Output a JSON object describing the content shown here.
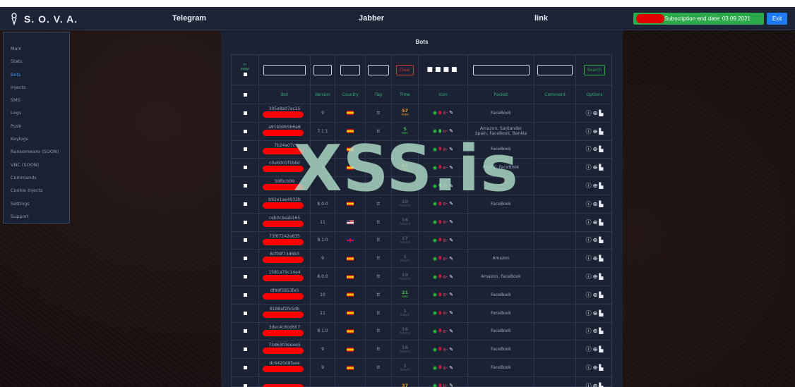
{
  "header": {
    "brand": "S. O. V. A.",
    "links": [
      "Telegram",
      "Jabber",
      "link"
    ],
    "subscription": "Subscription end date: 03.09.2021",
    "exit_label": "Exit"
  },
  "sidebar": {
    "items": [
      {
        "label": "Main"
      },
      {
        "label": "Stats"
      },
      {
        "label": "Bots",
        "active": true
      },
      {
        "label": "Injects"
      },
      {
        "label": "SMS"
      },
      {
        "label": "Logs"
      },
      {
        "label": "Push"
      },
      {
        "label": "Keylogs"
      },
      {
        "label": "Ransomware (SOON)"
      },
      {
        "label": "VNC (SOON)"
      },
      {
        "label": "Commands"
      },
      {
        "label": "Cookie Injects"
      },
      {
        "label": "Settings"
      },
      {
        "label": "Support"
      }
    ]
  },
  "panel": {
    "title": "Bots",
    "per_page_label": "in\npage",
    "clear_label": "Clear",
    "search_label": "Search",
    "dots": "■■■■",
    "columns": [
      "Bot",
      "Version",
      "Country",
      "Tag",
      "Time",
      "Icon",
      "Packet",
      "Comment",
      "Options"
    ]
  },
  "rows": [
    {
      "bot": "305e8a07ac15",
      "version": "9",
      "country": "es",
      "tag": "tt",
      "time_n": "57",
      "time_u": "min",
      "time_c": "o",
      "packet": "FaceBook",
      "bug_green": false
    },
    {
      "bot": "a91bb9b5b6a8",
      "version": "7.1.1",
      "country": "es",
      "tag": "tt",
      "time_n": "5",
      "time_u": "sec",
      "time_c": "g",
      "packet": "Amazon, Santander\nSpain, FaceBook, Bankia",
      "bug_green": true
    },
    {
      "bot": "7b24a07c",
      "version": "",
      "country": "es",
      "tag": "",
      "time_n": "",
      "time_u": "",
      "time_c": "",
      "packet": "FaceBook",
      "bug_green": false
    },
    {
      "bot": "c0e6003f1b6d",
      "version": "9",
      "country": "es",
      "tag": "",
      "time_n": "51",
      "time_u": "min",
      "time_c": "o",
      "packet": "PayPal, FaceBook",
      "bug_green": false
    },
    {
      "bot": "59fbcb99",
      "version": "",
      "country": "",
      "tag": "",
      "time_n": "",
      "time_u": "",
      "time_c": "",
      "packet": "",
      "bug_green": true
    },
    {
      "bot": "b92e1ae4932b",
      "version": "8.0.0",
      "country": "es",
      "tag": "tt",
      "time_n": "10",
      "time_u": "hours",
      "time_c": "",
      "packet": "FaceBook",
      "bug_green": false
    },
    {
      "bot": "ceb0cbeab165",
      "version": "11",
      "country": "us",
      "tag": "tt",
      "time_n": "16",
      "time_u": "hours",
      "time_c": "",
      "packet": "",
      "bug_green": false
    },
    {
      "bot": "73f67242e835",
      "version": "8.1.0",
      "country": "gb",
      "tag": "tt",
      "time_n": "17",
      "time_u": "hours",
      "time_c": "",
      "packet": "",
      "bug_green": false
    },
    {
      "bot": "8cf09f73d6b3",
      "version": "9",
      "country": "es",
      "tag": "tt",
      "time_n": "1",
      "time_u": "days",
      "time_c": "",
      "packet": "Amazon",
      "bug_green": false
    },
    {
      "bot": "1581a79c14e4",
      "version": "8.0.0",
      "country": "es",
      "tag": "tt",
      "time_n": "19",
      "time_u": "hours",
      "time_c": "",
      "packet": "Amazon, FaceBook",
      "bug_green": false
    },
    {
      "bot": "df99f3953fe5",
      "version": "10",
      "country": "es",
      "tag": "tt",
      "time_n": "21",
      "time_u": "sec",
      "time_c": "g",
      "packet": "FaceBook",
      "bug_green": false
    },
    {
      "bot": "8188af2fe5db",
      "version": "11",
      "country": "es",
      "tag": "tt",
      "time_n": "1",
      "time_u": "days",
      "time_c": "",
      "packet": "FaceBook",
      "bug_green": false
    },
    {
      "bot": "3dec4c80d607",
      "version": "8.1.0",
      "country": "es",
      "tag": "tt",
      "time_n": "16",
      "time_u": "hours",
      "time_c": "",
      "packet": "FaceBook",
      "bug_green": false
    },
    {
      "bot": "73d6303eeee5",
      "version": "9",
      "country": "es",
      "tag": "tt",
      "time_n": "16",
      "time_u": "hours",
      "time_c": "",
      "packet": "FaceBook",
      "bug_green": false
    },
    {
      "bot": "dc6420d8faee",
      "version": "9",
      "country": "es",
      "tag": "tt",
      "time_n": "1",
      "time_u": "days",
      "time_c": "",
      "packet": "FaceBook",
      "bug_green": false
    },
    {
      "bot": "",
      "version": "",
      "country": "",
      "tag": "",
      "time_n": "37",
      "time_u": "",
      "time_c": "o",
      "packet": "",
      "bug_green": false
    }
  ],
  "icons": {
    "eye": "eye-icon",
    "bug": "bug-icon",
    "key": "key-icon",
    "edit": "pencil-icon",
    "info": "info-icon",
    "add": "plus-circle-icon",
    "file": "file-icon"
  },
  "watermark": "XSS.is",
  "colors": {
    "accent": "#1f7cf0",
    "green": "#2ba84a",
    "redaction": "#ff0000",
    "header_text": "#36b07a"
  }
}
